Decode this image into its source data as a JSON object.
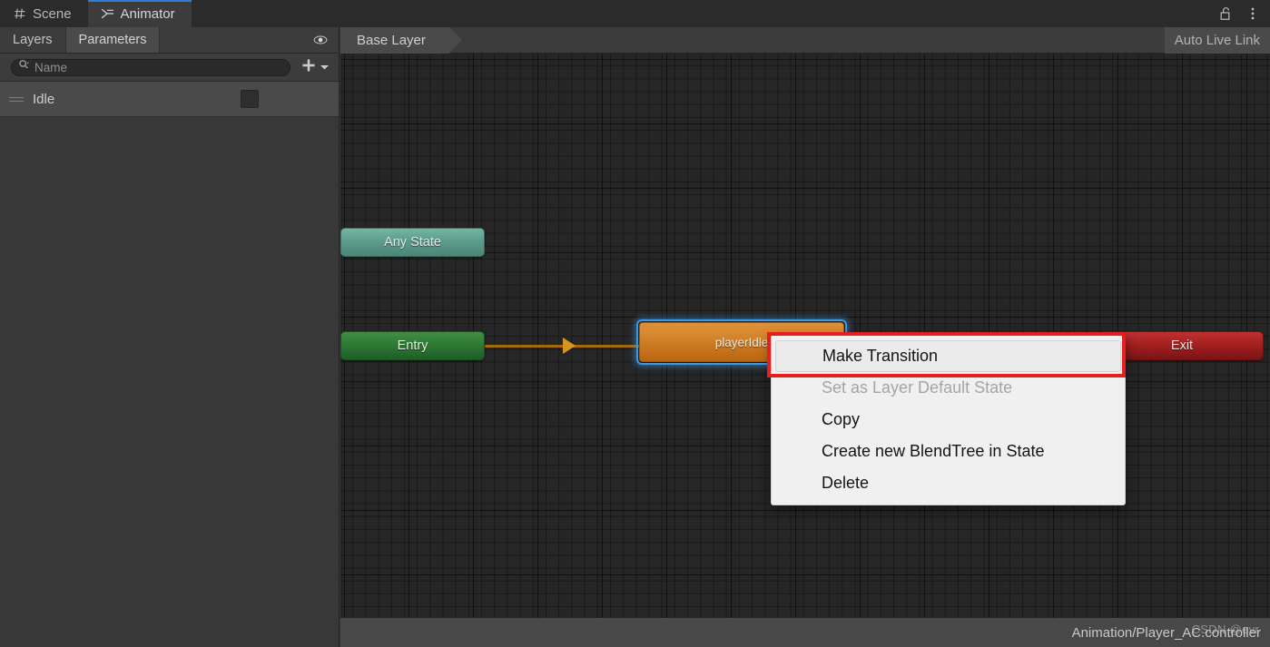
{
  "window": {
    "tabs": [
      {
        "label": "Scene",
        "icon": "grid-icon",
        "active": false
      },
      {
        "label": "Animator",
        "icon": "animator-icon",
        "active": true
      }
    ],
    "lock_icon": "lock-open-icon",
    "menu_icon": "kebab-menu-icon"
  },
  "left_panel": {
    "tabs": [
      {
        "label": "Layers",
        "selected": false
      },
      {
        "label": "Parameters",
        "selected": true
      }
    ],
    "visibility_icon": "eye-icon",
    "search": {
      "placeholder": "Name",
      "value": "",
      "icon": "search-icon"
    },
    "add_button": {
      "label": "+",
      "icon": "plus-icon",
      "dropdown_icon": "chevron-down-icon"
    },
    "layers": [
      {
        "name": "Idle",
        "grip_icon": "drag-handle-icon",
        "weight_mask": ""
      }
    ]
  },
  "graph_header": {
    "breadcrumb": "Base Layer",
    "live_link": "Auto Live Link"
  },
  "graph": {
    "nodes": [
      {
        "id": "any-state",
        "label": "Any State",
        "color": "#5d9c8c",
        "selected": false
      },
      {
        "id": "entry",
        "label": "Entry",
        "color": "#2f7a35",
        "selected": false
      },
      {
        "id": "player-idle",
        "label": "playerIdle",
        "color": "#d4842c",
        "selected": true
      },
      {
        "id": "exit",
        "label": "Exit",
        "color": "#a52020",
        "selected": false
      }
    ],
    "transitions": [
      {
        "from": "entry",
        "to": "player-idle",
        "color": "#d89520"
      }
    ]
  },
  "context_menu": {
    "items": [
      {
        "label": "Make Transition",
        "state": "highlighted"
      },
      {
        "label": "Set as Layer Default State",
        "state": "disabled"
      },
      {
        "label": "Copy",
        "state": "normal"
      },
      {
        "label": "Create new BlendTree in State",
        "state": "normal"
      },
      {
        "label": "Delete",
        "state": "normal"
      }
    ]
  },
  "status_bar": {
    "path": "Animation/Player_AC.controller"
  },
  "watermark": {
    "text": "CSDN @evr"
  },
  "colors": {
    "accent": "#2c7fd4",
    "annotation": "#e81e1e",
    "selection": "#3a9ae8"
  }
}
